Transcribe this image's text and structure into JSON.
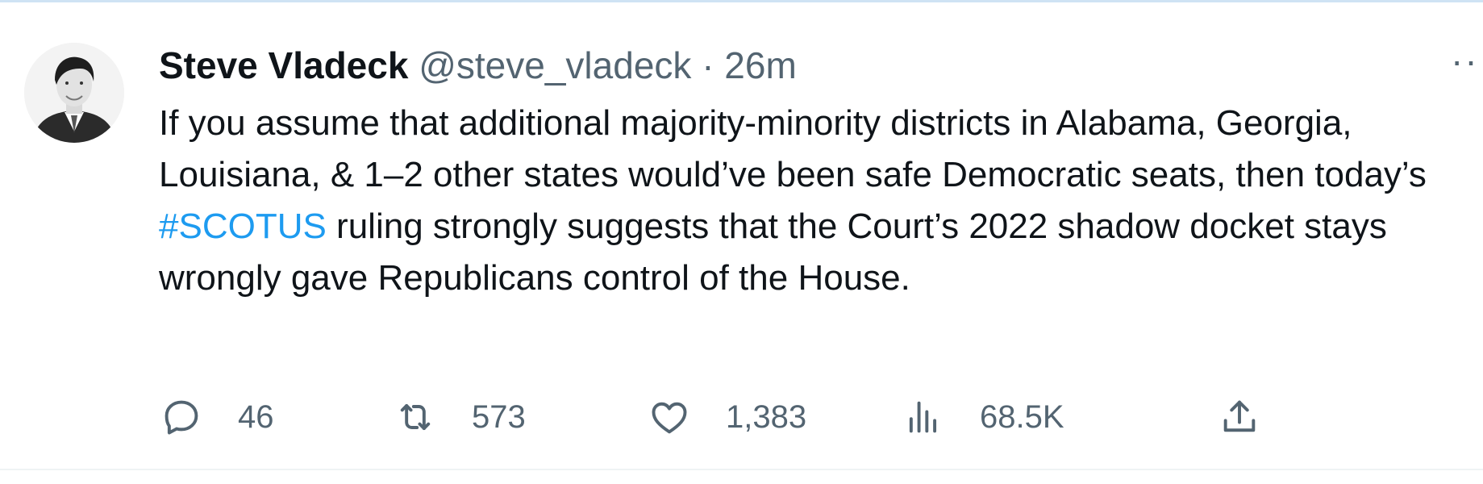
{
  "tweet": {
    "author": {
      "display_name": "Steve Vladeck",
      "handle": "@steve_vladeck",
      "separator": "·",
      "time": "26m"
    },
    "text": {
      "before": "If you assume that additional majority-minority districts in Alabama, Georgia, Louisiana, & 1–2 other states would’ve been safe Democratic seats, then today’s ",
      "hashtag": "#SCOTUS",
      "after": " ruling strongly suggests that the Court’s 2022 shadow docket stays wrongly gave Republicans control of the House."
    },
    "more_label": "···",
    "actions": {
      "replies": "46",
      "retweets": "573",
      "likes": "1,383",
      "views": "68.5K"
    }
  },
  "icons": {
    "reply": "reply-icon",
    "retweet": "retweet-icon",
    "like": "heart-icon",
    "views": "views-icon",
    "share": "share-icon",
    "more": "more-icon"
  },
  "colors": {
    "text": "#0f1419",
    "secondary": "#536471",
    "link": "#1d9bf0",
    "divider": "#eff3f4"
  }
}
